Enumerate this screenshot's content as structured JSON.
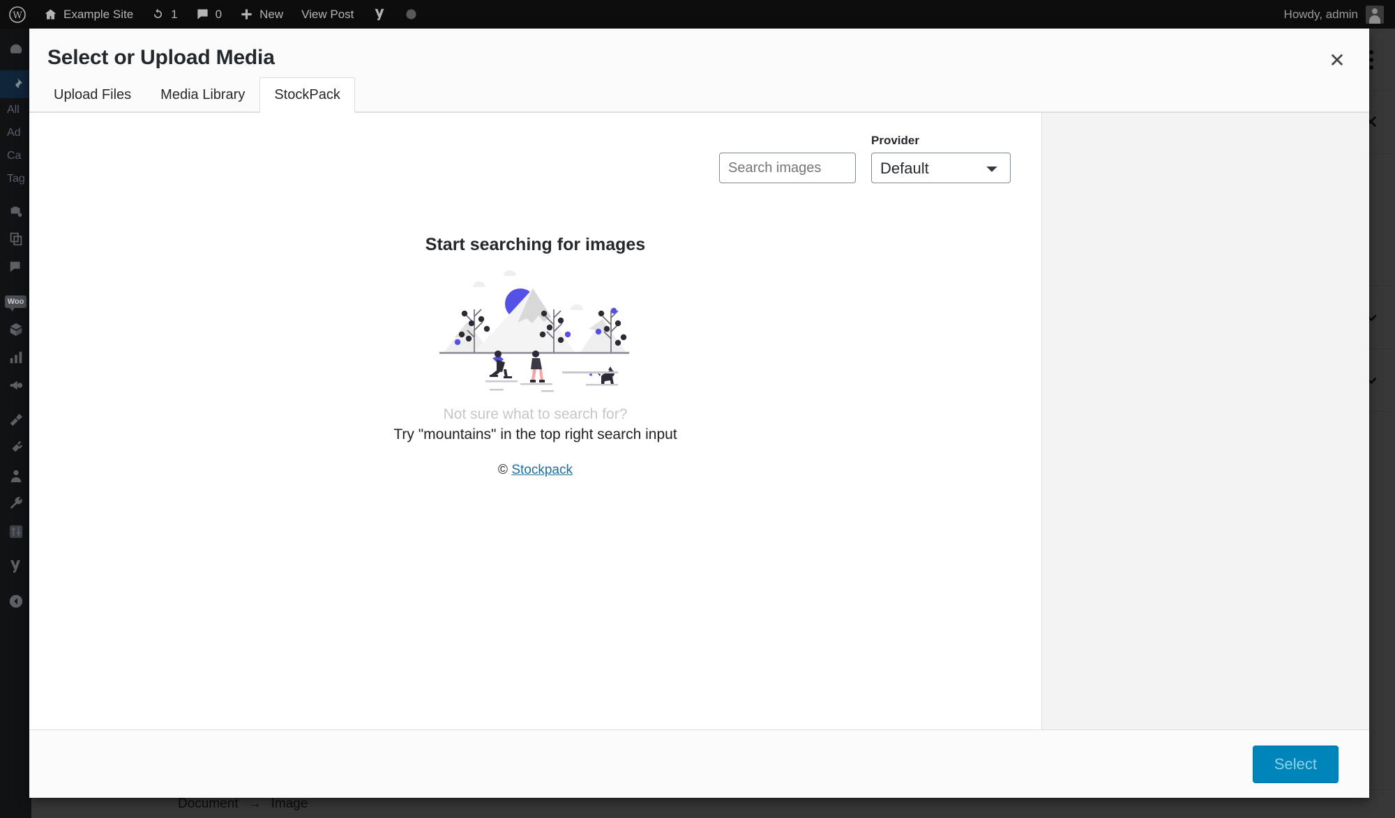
{
  "adminbar": {
    "logo_icon": "wordpress-logo-icon",
    "site_icon": "home-icon",
    "site_name": "Example Site",
    "updates_icon": "updates-icon",
    "updates_count": "1",
    "comments_icon": "comment-bubble-icon",
    "comments_count": "0",
    "new_icon": "plus-icon",
    "new_label": "New",
    "view_post_label": "View Post",
    "yoast_icon": "yoast-seo-icon",
    "recording_icon": "circle-icon",
    "howdy": "Howdy, admin",
    "avatar": "user-avatar"
  },
  "adminmenu": {
    "items": [
      {
        "icon": "dashboard-icon"
      },
      {
        "icon": "pin-posts-icon",
        "active": true
      }
    ],
    "submenu": [
      "All",
      "Ad",
      "Ca",
      "Tag"
    ],
    "lower_items": [
      {
        "icon": "media-camera-icon"
      },
      {
        "icon": "pages-icon"
      },
      {
        "icon": "comments-icon"
      },
      {
        "icon": "woocommerce-icon",
        "badge": "Woo"
      },
      {
        "icon": "products-box-icon"
      },
      {
        "icon": "analytics-bars-icon"
      },
      {
        "icon": "marketing-megaphone-icon"
      },
      {
        "icon": "appearance-brush-icon"
      },
      {
        "icon": "plugins-plug-icon"
      },
      {
        "icon": "users-icon"
      },
      {
        "icon": "tools-wrench-icon"
      },
      {
        "icon": "settings-sliders-icon"
      },
      {
        "icon": "yoast-seo-icon"
      },
      {
        "icon": "collapse-menu-icon"
      }
    ]
  },
  "editor": {
    "kebab_icon": "more-options-icon",
    "close_icon": "close-icon",
    "panel_toggle_icon": "chevron-down-icon",
    "breadcrumb": [
      "Document",
      "Image"
    ],
    "breadcrumb_separator": "→"
  },
  "modal": {
    "title": "Select or Upload Media",
    "close_icon": "close-icon",
    "close_label": "✕",
    "tabs": [
      {
        "label": "Upload Files",
        "active": false
      },
      {
        "label": "Media Library",
        "active": false
      },
      {
        "label": "StockPack",
        "active": true
      }
    ],
    "search": {
      "placeholder": "Search images",
      "value": "",
      "icon": "search-icon"
    },
    "provider": {
      "label": "Provider",
      "selected": "Default",
      "options": [
        "Default"
      ],
      "chevron_icon": "chevron-down-icon"
    },
    "empty_state": {
      "title": "Start searching for images",
      "illustration": "mountains-hikers-illustration",
      "hint_muted": "Not sure what to search for?",
      "hint_main": "Try \"mountains\" in the top right search input",
      "credit_symbol": "©",
      "credit_link": "Stockpack"
    },
    "footer": {
      "select_label": "Select"
    }
  },
  "colors": {
    "accent_blue": "#0085ba",
    "link_blue": "#1f6f9e",
    "illustration_purple": "#5550e6",
    "adminbar_bg": "#0d0d0d",
    "adminmenu_bg": "#101214",
    "active_menu_bg": "#10253a",
    "panel_gray": "#f3f3f3",
    "border_gray": "#dddddd"
  }
}
